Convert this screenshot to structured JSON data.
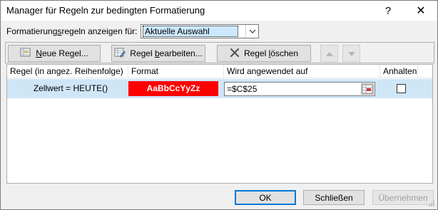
{
  "window": {
    "title": "Manager für Regeln zur bedingten Formatierung",
    "help_glyph": "?",
    "close_glyph": "✕"
  },
  "filter": {
    "label_pre": "Formatierung",
    "label_mnemonic": "s",
    "label_post": "regeln anzeigen für:",
    "selected": "Aktuelle Auswahl"
  },
  "toolbar": {
    "new_mnemonic": "N",
    "new_rest": "eue Regel...",
    "edit_pre": "Regel ",
    "edit_mnemonic": "b",
    "edit_rest": "earbeiten...",
    "delete_pre": "Regel ",
    "delete_mnemonic": "l",
    "delete_rest": "öschen"
  },
  "table": {
    "headers": [
      "Regel (in angez. Reihenfolge)",
      "Format",
      "Wird angewendet auf",
      "Anhalten"
    ],
    "rows": [
      {
        "rule": "Zellwert = HEUTE()",
        "format_preview": "AaBbCcYyZz",
        "applies_to": "=$C$25",
        "stop_if_true": false
      }
    ]
  },
  "footer": {
    "ok": "OK",
    "close": "Schließen",
    "apply": "Übernehmen"
  },
  "colors": {
    "format_fill": "#ff0000",
    "format_text": "#ffffff",
    "row_selected": "#cfe6f7",
    "accent": "#0078d7"
  }
}
